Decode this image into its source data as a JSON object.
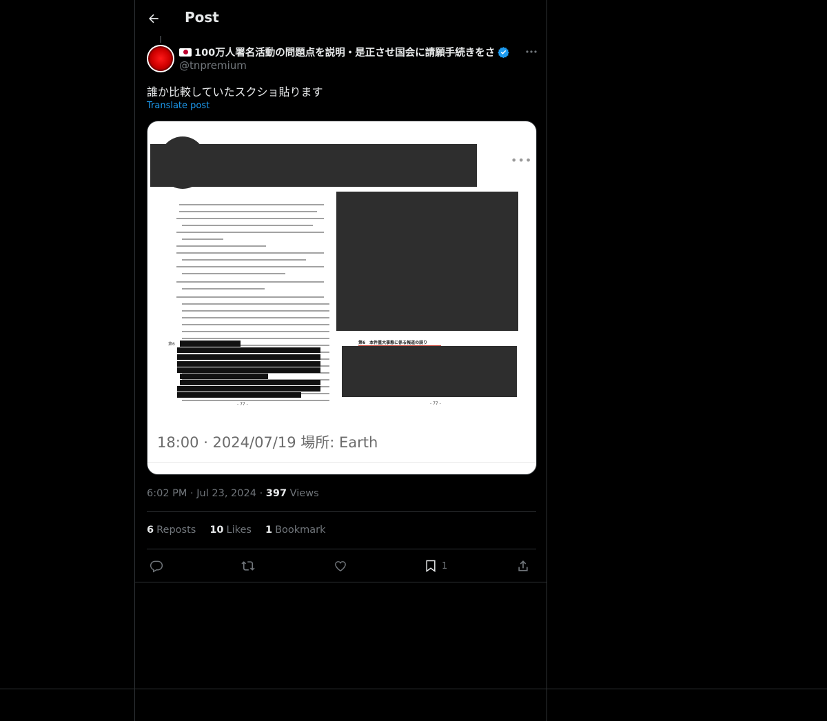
{
  "header": {
    "title": "Post"
  },
  "post": {
    "display_name": "100万人署名活動の問題点を説明・是正させ国会に請願手続きをさ",
    "handle": "@tnpremium",
    "text": "誰か比較していたスクショ貼ります",
    "translate_label": "Translate post",
    "media": {
      "screenshot_time": "18:00 · 2024/07/19 場所: Earth",
      "page_label_left": "第6",
      "page_num_left": "- 77 -",
      "page_num_right": "- 77 -",
      "section_right": "第6　本件重大事態に係る報道の誤り"
    },
    "time": "6:02 PM",
    "date": "Jul 23, 2024",
    "views_count": "397",
    "views_label": "Views",
    "reposts_count": "6",
    "reposts_label": "Reposts",
    "likes_count": "10",
    "likes_label": "Likes",
    "bookmarks_count": "1",
    "bookmarks_label": "Bookmark",
    "bookmark_action_count": "1"
  },
  "colors": {
    "accent": "#1d9bf0",
    "background": "#000000",
    "muted": "#71767b",
    "text": "#e7e9ea"
  },
  "icons": [
    "back-arrow-icon",
    "verified-badge-icon",
    "more-icon",
    "reply-icon",
    "repost-icon",
    "like-icon",
    "bookmark-icon",
    "share-icon"
  ]
}
